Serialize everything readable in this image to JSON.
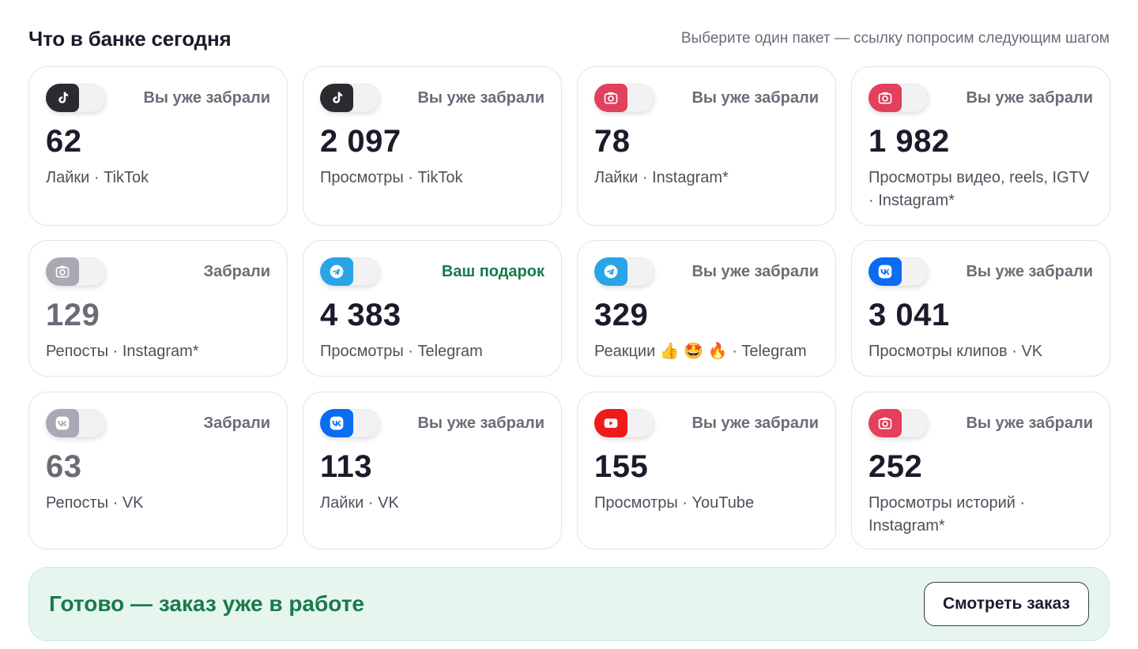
{
  "header": {
    "title": "Что в банке сегодня",
    "hint": "Выберите один пакет — ссылку попросим следующим шагом"
  },
  "colors": {
    "tiktok": "#2b2b2f",
    "instagram": "#e2405c",
    "telegram": "#2aa4e6",
    "vk": "#0a6cf0",
    "youtube": "#f01a1a",
    "disabled": "#a9a9b3",
    "gift": "#16794a"
  },
  "cards": [
    {
      "icon": "tiktok-icon",
      "status": "Вы уже забрали",
      "value": "62",
      "label": "Лайки · TikTok"
    },
    {
      "icon": "tiktok-icon",
      "status": "Вы уже забрали",
      "value": "2 097",
      "label": "Просмотры · TikTok"
    },
    {
      "icon": "instagram-icon",
      "status": "Вы уже забрали",
      "value": "78",
      "label": "Лайки · Instagram*"
    },
    {
      "icon": "instagram-icon",
      "status": "Вы уже забрали",
      "value": "1 982",
      "label": "Просмотры видео, reels, IGTV · Instagram*"
    },
    {
      "icon": "instagram-icon",
      "status": "Забрали",
      "value": "129",
      "label": "Репосты · Instagram*"
    },
    {
      "icon": "telegram-icon",
      "status": "Ваш подарок",
      "value": "4 383",
      "label": "Просмотры · Telegram"
    },
    {
      "icon": "telegram-icon",
      "status": "Вы уже забрали",
      "value": "329",
      "label": "Реакции 👍 🤩 🔥  · Telegram"
    },
    {
      "icon": "vk-icon",
      "status": "Вы уже забрали",
      "value": "3 041",
      "label": "Просмотры клипов · VK"
    },
    {
      "icon": "vk-icon",
      "status": "Забрали",
      "value": "63",
      "label": "Репосты · VK"
    },
    {
      "icon": "vk-icon",
      "status": "Вы уже забрали",
      "value": "113",
      "label": "Лайки · VK"
    },
    {
      "icon": "youtube-icon",
      "status": "Вы уже забрали",
      "value": "155",
      "label": "Просмотры · YouTube"
    },
    {
      "icon": "instagram-icon",
      "status": "Вы уже забрали",
      "value": "252",
      "label": "Просмотры историй · Instagram*"
    }
  ],
  "banner": {
    "text": "Готово — заказ уже в работе",
    "button": "Смотреть заказ"
  }
}
